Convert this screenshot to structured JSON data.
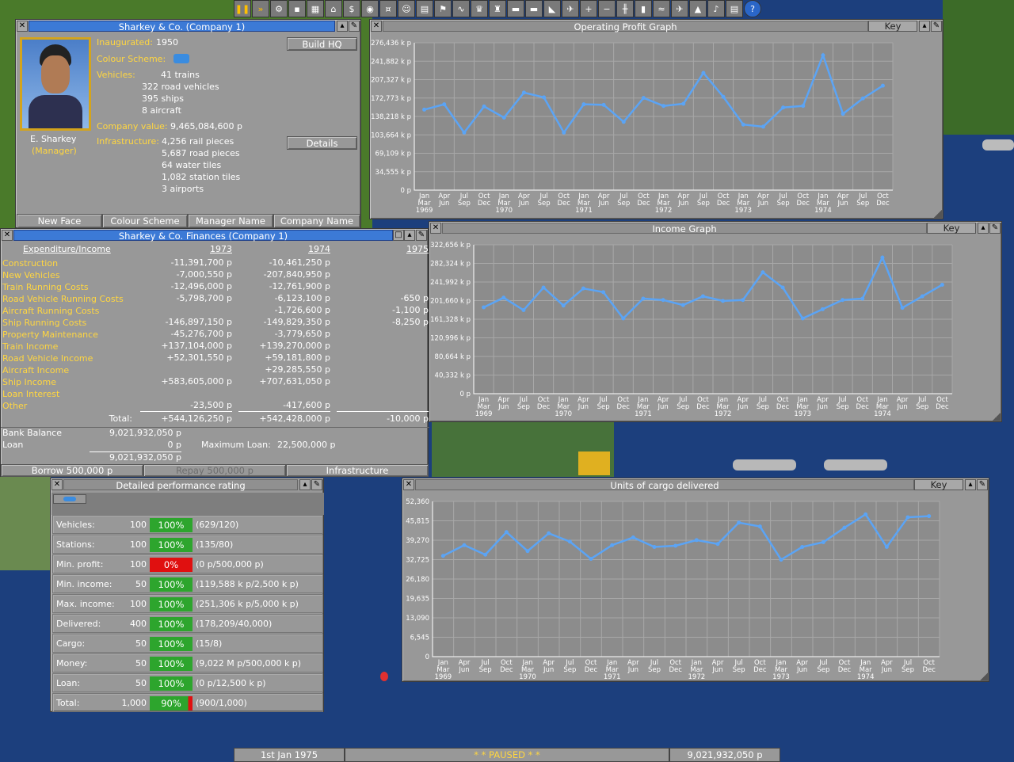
{
  "toolbar": {
    "icons": [
      "pause-icon",
      "fast-forward-icon",
      "settings-icon",
      "save-icon",
      "map-icon",
      "town-directory-icon",
      "subsidies-icon",
      "station-list-icon",
      "finances-icon",
      "company-icon",
      "story-icon",
      "goal-icon",
      "graphs-icon",
      "league-icon",
      "industry-icon",
      "train-list-icon",
      "road-vehicle-list-icon",
      "ship-list-icon",
      "aircraft-list-icon",
      "zoom-in-icon",
      "zoom-out-icon",
      "build-rail-icon",
      "build-road-icon",
      "build-water-icon",
      "build-air-icon",
      "landscape-icon",
      "music-icon",
      "newspaper-icon",
      "help-icon"
    ]
  },
  "company": {
    "title": "Sharkey & Co. (Company 1)",
    "manager_name": "E. Sharkey",
    "manager_role": "(Manager)",
    "inaugurated_label": "Inaugurated:",
    "inaugurated": "1950",
    "colour_label": "Colour Scheme:",
    "vehicles_label": "Vehicles:",
    "vehicles": [
      "41 trains",
      "322 road vehicles",
      "395 ships",
      "8 aircraft"
    ],
    "value_label": "Company value:",
    "value": "9,465,084,600 p",
    "infra_label": "Infrastructure:",
    "infra": [
      "4,256 rail pieces",
      "5,687 road pieces",
      "64 water tiles",
      "1,082 station tiles",
      "3 airports"
    ],
    "build_hq": "Build HQ",
    "details": "Details",
    "new_face": "New Face",
    "colour_scheme": "Colour Scheme",
    "manager_name_btn": "Manager Name",
    "company_name_btn": "Company Name"
  },
  "finances": {
    "title": "Sharkey & Co. Finances (Company 1)",
    "header": "Expenditure/Income",
    "years": [
      "1973",
      "1974",
      "1975"
    ],
    "rows": [
      {
        "label": "Construction",
        "v": [
          "-11,391,700 p",
          "-10,461,250 p",
          ""
        ]
      },
      {
        "label": "New Vehicles",
        "v": [
          "-7,000,550 p",
          "-207,840,950 p",
          ""
        ]
      },
      {
        "label": "Train Running Costs",
        "v": [
          "-12,496,000 p",
          "-12,761,900 p",
          ""
        ]
      },
      {
        "label": "Road Vehicle Running Costs",
        "v": [
          "-5,798,700 p",
          "-6,123,100 p",
          "-650 p"
        ]
      },
      {
        "label": "Aircraft Running Costs",
        "v": [
          "",
          "-1,726,600 p",
          "-1,100 p"
        ]
      },
      {
        "label": "Ship Running Costs",
        "v": [
          "-146,897,150 p",
          "-149,829,350 p",
          "-8,250 p"
        ]
      },
      {
        "label": "Property Maintenance",
        "v": [
          "-45,276,700 p",
          "-3,779,650 p",
          ""
        ]
      },
      {
        "label": "Train Income",
        "v": [
          "+137,104,000 p",
          "+139,270,000 p",
          ""
        ]
      },
      {
        "label": "Road Vehicle Income",
        "v": [
          "+52,301,550 p",
          "+59,181,800 p",
          ""
        ]
      },
      {
        "label": "Aircraft Income",
        "v": [
          "",
          "+29,285,550 p",
          ""
        ]
      },
      {
        "label": "Ship Income",
        "v": [
          "+583,605,000 p",
          "+707,631,050 p",
          ""
        ]
      },
      {
        "label": "Loan Interest",
        "v": [
          "",
          "",
          ""
        ]
      },
      {
        "label": "Other",
        "v": [
          "-23,500 p",
          "-417,600 p",
          ""
        ]
      }
    ],
    "total_label": "Total:",
    "totals": [
      "+544,126,250 p",
      "+542,428,000 p",
      "-10,000 p"
    ],
    "bank_label": "Bank Balance",
    "bank": "9,021,932,050 p",
    "loan_label": "Loan",
    "loan": "0 p",
    "net": "9,021,932,050 p",
    "maxloan_label": "Maximum Loan:",
    "maxloan": "22,500,000 p",
    "borrow": "Borrow 500,000 p",
    "repay": "Repay 500,000 p",
    "infrastructure": "Infrastructure"
  },
  "perf": {
    "title": "Detailed performance rating",
    "rows": [
      {
        "label": "Vehicles:",
        "score": "100",
        "pct": "100%",
        "frac": 1,
        "detail": "(629/120)"
      },
      {
        "label": "Stations:",
        "score": "100",
        "pct": "100%",
        "frac": 1,
        "detail": "(135/80)"
      },
      {
        "label": "Min. profit:",
        "score": "100",
        "pct": "0%",
        "frac": 0,
        "detail": "(0 p/500,000 p)"
      },
      {
        "label": "Min. income:",
        "score": "50",
        "pct": "100%",
        "frac": 1,
        "detail": "(119,588 k p/2,500 k p)"
      },
      {
        "label": "Max. income:",
        "score": "100",
        "pct": "100%",
        "frac": 1,
        "detail": "(251,306 k p/5,000 k p)"
      },
      {
        "label": "Delivered:",
        "score": "400",
        "pct": "100%",
        "frac": 1,
        "detail": "(178,209/40,000)"
      },
      {
        "label": "Cargo:",
        "score": "50",
        "pct": "100%",
        "frac": 1,
        "detail": "(15/8)"
      },
      {
        "label": "Money:",
        "score": "50",
        "pct": "100%",
        "frac": 1,
        "detail": "(9,022 M p/500,000 k p)"
      },
      {
        "label": "Loan:",
        "score": "50",
        "pct": "100%",
        "frac": 1,
        "detail": "(0 p/12,500 k p)"
      },
      {
        "label": "Total:",
        "score": "1,000",
        "pct": "90%",
        "frac": 0.9,
        "detail": "(900/1,000)"
      }
    ]
  },
  "graph_key": "Key",
  "xaxis": {
    "q": [
      "Jan",
      "Apr",
      "Jul",
      "Oct"
    ],
    "q2": [
      "Mar",
      "Jun",
      "Sep",
      "Dec"
    ],
    "years": [
      "1969",
      "1970",
      "1971",
      "1972",
      "1973",
      "1974"
    ]
  },
  "chart_data": [
    {
      "type": "line",
      "title": "Operating Profit Graph",
      "ytick_labels": [
        "276,436 k p",
        "241,882 k p",
        "207,327 k p",
        "172,773 k p",
        "138,218 k p",
        "103,664 k p",
        "69,109 k p",
        "34,555 k p",
        "0 p"
      ],
      "ylim": [
        0,
        276436
      ],
      "grid": true,
      "values": [
        151000,
        161000,
        108000,
        157000,
        136000,
        183000,
        174000,
        108000,
        161000,
        160000,
        128000,
        173000,
        158000,
        162000,
        220000,
        175000,
        123000,
        119000,
        155000,
        158000,
        253000,
        143000,
        172000,
        196000
      ]
    },
    {
      "type": "line",
      "title": "Income Graph",
      "ytick_labels": [
        "322,656 k p",
        "282,324 k p",
        "241,992 k p",
        "201,660 k p",
        "161,328 k p",
        "120,996 k p",
        "80,664 k p",
        "40,332 k p",
        "0 p"
      ],
      "ylim": [
        0,
        322656
      ],
      "grid": true,
      "values": [
        187000,
        208000,
        181000,
        230000,
        191000,
        228000,
        220000,
        163000,
        206000,
        203000,
        192000,
        211000,
        201000,
        203000,
        263000,
        230000,
        163000,
        183000,
        203000,
        206000,
        295000,
        186000,
        211000,
        236000
      ]
    },
    {
      "type": "line",
      "title": "Units of cargo delivered",
      "ytick_labels": [
        "52,360",
        "45,815",
        "39,270",
        "32,725",
        "26,180",
        "19,635",
        "13,090",
        "6,545",
        "0"
      ],
      "ylim": [
        0,
        52360
      ],
      "grid": true,
      "values": [
        34000,
        37600,
        34400,
        42000,
        35600,
        41600,
        38800,
        33000,
        37600,
        40200,
        37000,
        37400,
        39300,
        38000,
        45200,
        43900,
        32700,
        37000,
        38600,
        43500,
        48000,
        37000,
        47000,
        47400
      ]
    }
  ],
  "status": {
    "date": "1st Jan 1975",
    "paused": "* * PAUSED * *",
    "money": "9,021,932,050 p"
  },
  "colors": {
    "line": "#5ba4f5",
    "grid": "#a8a8a8",
    "label": "#ffd640",
    "bar_good": "#2da52d",
    "bar_bad": "#e01010"
  }
}
